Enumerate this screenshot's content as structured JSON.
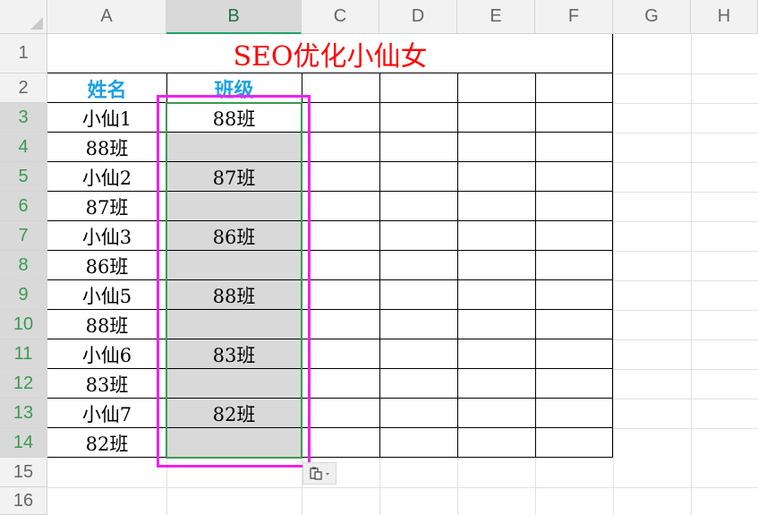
{
  "columns": [
    "A",
    "B",
    "C",
    "D",
    "E",
    "F",
    "G",
    "H"
  ],
  "rows": [
    "1",
    "2",
    "3",
    "4",
    "5",
    "6",
    "7",
    "8",
    "9",
    "10",
    "11",
    "12",
    "13",
    "14",
    "15",
    "16"
  ],
  "title": "SEO优化小仙女",
  "headers": {
    "name": "姓名",
    "class": "班级"
  },
  "column_a": [
    "小仙1",
    "88班",
    "小仙2",
    "87班",
    "小仙3",
    "86班",
    "小仙5",
    "88班",
    "小仙6",
    "83班",
    "小仙7",
    "82班"
  ],
  "column_b": [
    "88班",
    "",
    "87班",
    "",
    "86班",
    "",
    "88班",
    "",
    "83班",
    "",
    "82班",
    ""
  ],
  "paste_options_icon": "paste-options-icon",
  "colors": {
    "title": "#ff0000",
    "header_text": "#1aa0e6",
    "selection_border": "#3b9b4f",
    "highlight_box": "#f020f0",
    "selection_fill": "#d9d9d9"
  }
}
